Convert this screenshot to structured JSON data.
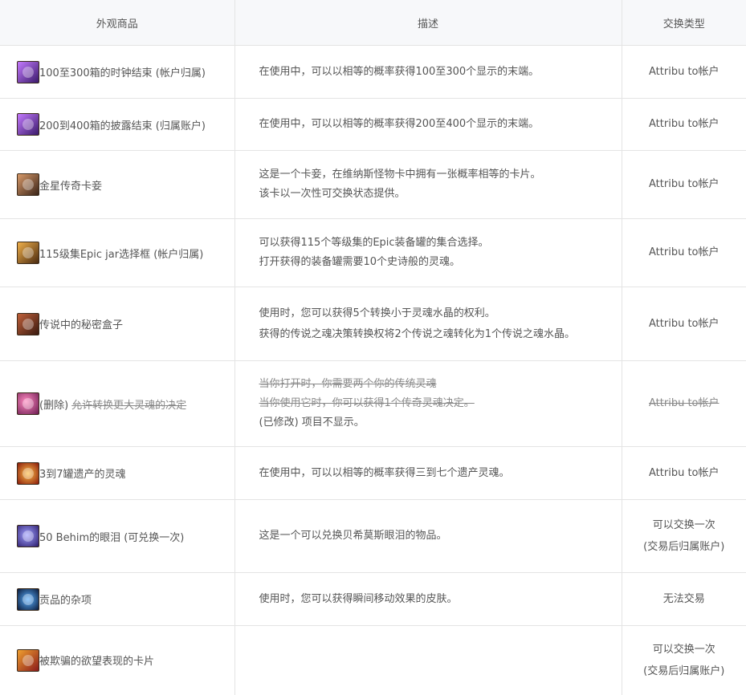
{
  "header": {
    "col_item": "外观商品",
    "col_desc": "描述",
    "col_exchange": "交换类型"
  },
  "rows": [
    {
      "icon": "purple-clock-box-icon",
      "icon_color": "#7a3bbf",
      "name": "100至300箱的时钟结束 (帐户归属)",
      "desc": [
        "在使用中，可以以相等的概率获得100至300个显示的末端。"
      ],
      "exchange": [
        "Attribu to帐户"
      ]
    },
    {
      "icon": "purple-clock-box-icon",
      "icon_color": "#7a3bbf",
      "name": "200到400箱的披露结束 (归属账户)",
      "desc": [
        "在使用中，可以以相等的概率获得200至400个显示的末端。"
      ],
      "exchange": [
        "Attribu to帐户"
      ]
    },
    {
      "icon": "card-icon",
      "icon_color": "#8a5a3a",
      "name": "金星传奇卡妾",
      "desc": [
        "这是一个卡妾，在维纳斯怪物卡中拥有一张概率相等的卡片。",
        "该卡以一次性可交换状态提供。"
      ],
      "exchange": [
        "Attribu to帐户"
      ]
    },
    {
      "icon": "jar-box-icon",
      "icon_color": "#c0742a",
      "name": "115级集Epic jar选择框 (帐户归属)",
      "desc": [
        "可以获得115个等级集的Epic装备罐的集合选择。",
        "打开获得的装备罐需要10个史诗般的灵魂。"
      ],
      "exchange": [
        "Attribu to帐户"
      ]
    },
    {
      "icon": "mystery-box-icon",
      "icon_color": "#7a3a22",
      "name": "传说中的秘密盒子",
      "desc": [
        "使用时，您可以获得5个转换小于灵魂水晶的权利。",
        "获得的传说之魂决策转换权将2个传说之魂转化为1个传说之魂水晶。"
      ],
      "exchange": [
        "Attribu to帐户"
      ]
    },
    {
      "icon": "soul-orb-icon",
      "icon_color": "#b8326a",
      "name_prefix": "(删除)",
      "name": "允许转换更大灵魂的决定",
      "desc_struck": [
        "当你打开时，你需要两个你的传统灵魂",
        "当你使用它时，你可以获得1个传奇灵魂决定。"
      ],
      "desc": [
        "(已修改) 项目不显示。"
      ],
      "exchange_struck": "Attribu to帐户"
    },
    {
      "icon": "fire-soul-icon",
      "icon_color": "#d4541a",
      "name": "3到7罐遗产的灵魂",
      "desc": [
        "在使用中，可以以相等的概率获得三到七个遗产灵魂。"
      ],
      "exchange": [
        "Attribu to帐户"
      ]
    },
    {
      "icon": "tear-orb-icon",
      "icon_color": "#5a4ac0",
      "name": "50 Behim的眼泪 (可兑换一次)",
      "desc": [
        "这是一个可以兑换贝希莫斯眼泪的物品。"
      ],
      "exchange": [
        "可以交换一次",
        "(交易后归属账户)"
      ]
    },
    {
      "icon": "sparkle-icon",
      "icon_color": "#1a3a6a",
      "name": "贡品的杂项",
      "desc": [
        "使用时，您可以获得瞬间移动效果的皮肤。"
      ],
      "exchange": [
        "无法交易"
      ]
    },
    {
      "icon": "red-card-icon",
      "icon_color": "#b03030",
      "name": "被欺骗的欲望表现的卡片",
      "desc": [],
      "exchange": [
        "可以交换一次",
        "(交易后归属账户)"
      ]
    }
  ]
}
